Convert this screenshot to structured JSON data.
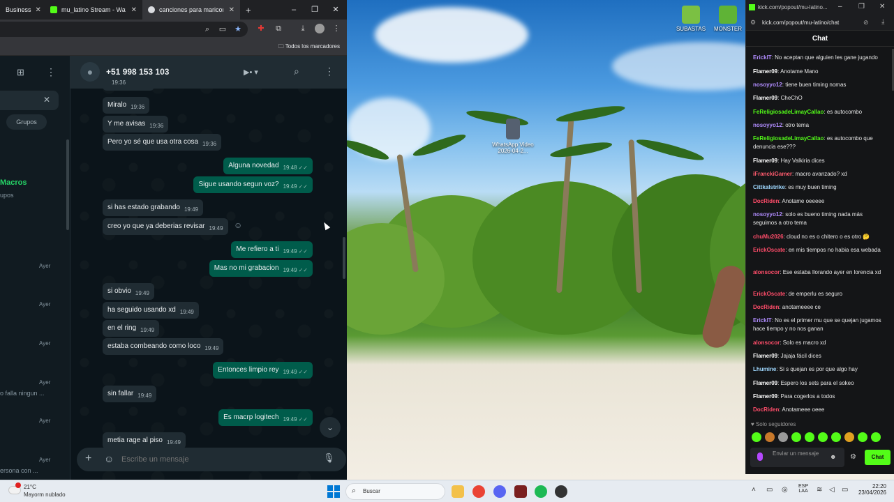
{
  "browser": {
    "tabs": [
      {
        "label": "Business",
        "close": "✕"
      },
      {
        "label": "mu_latino Stream - Watch",
        "close": "✕"
      },
      {
        "label": "canciones para maricones",
        "close": "✕"
      }
    ],
    "new_tab": "+",
    "bookmarks_label": "Todos los marcadores",
    "window_controls": [
      "–",
      "❐",
      "✕"
    ]
  },
  "wa_left": {
    "close_icon": "✕",
    "filter_chip": "Grupos",
    "chat_name_partial": "Macros",
    "chat_sub_partial": "upos",
    "times": [
      "Ayer",
      "Ayer",
      "Ayer",
      "Ayer",
      "Ayer",
      "Ayer"
    ],
    "preview_1": "o falla ningun ...",
    "preview_2": "ersona con ..."
  },
  "chat": {
    "contact": "+51 998 153 103",
    "messages": [
      {
        "dir": "in",
        "text": "",
        "time": "19:36"
      },
      {
        "dir": "in",
        "text": "Miralo",
        "time": "19:36"
      },
      {
        "dir": "in",
        "text": "Y me avisas",
        "time": "19:36"
      },
      {
        "dir": "in",
        "text": "Pero yo sé que usa otra cosa",
        "time": "19:36"
      },
      {
        "dir": "out",
        "text": "Alguna novedad",
        "time": "19:48"
      },
      {
        "dir": "out",
        "text": "Sigue usando segun voz?",
        "time": "19:49"
      },
      {
        "dir": "in",
        "text": "si has estado grabando",
        "time": "19:49"
      },
      {
        "dir": "in",
        "text": "creo yo que ya deberias revisar",
        "time": "19:49"
      },
      {
        "dir": "out",
        "text": "Me refiero a ti",
        "time": "19:49"
      },
      {
        "dir": "out",
        "text": "Mas no mi grabacion",
        "time": "19:49"
      },
      {
        "dir": "in",
        "text": "si obvio",
        "time": "19:49"
      },
      {
        "dir": "in",
        "text": "ha seguido usando xd",
        "time": "19:49"
      },
      {
        "dir": "in",
        "text": "en el ring",
        "time": "19:49"
      },
      {
        "dir": "in",
        "text": "estaba combeando como loco",
        "time": "19:49"
      },
      {
        "dir": "out",
        "text": "Entonces limpio rey",
        "time": "19:49"
      },
      {
        "dir": "in",
        "text": "sin fallar",
        "time": "19:49"
      },
      {
        "dir": "out",
        "text": "Es macrp logitech",
        "time": "19:49"
      },
      {
        "dir": "in",
        "text": "metia rage al piso",
        "time": "19:49"
      }
    ],
    "tick": "✓✓",
    "compose_placeholder": "Escribe un mensaje"
  },
  "desktop": {
    "icons": [
      {
        "label": "SUBASTAS"
      },
      {
        "label": "MONSTER"
      },
      {
        "label": "WhatsApp Video 2026-04-2..."
      }
    ]
  },
  "kick": {
    "url": "kick.com/popout/mu-latino/chat",
    "tab_url": "kick.com/popout/mu-latino...",
    "header": "Chat",
    "messages": [
      {
        "user": "ErickIT",
        "color": "#b18cff",
        "text": "No aceptan que alguien les gane jugando"
      },
      {
        "user": "Flamer09",
        "color": "#ffffff",
        "text": "Anotame Mano"
      },
      {
        "user": "nosoyyo12",
        "color": "#b18cff",
        "text": "tiene buen timing nomas"
      },
      {
        "user": "Flamer09",
        "color": "#ffffff",
        "text": "CheChO"
      },
      {
        "user": "FeReligiosadeLimayCallao",
        "color": "#53fc18",
        "text": "es autocombo"
      },
      {
        "user": "nosoyyo12",
        "color": "#b18cff",
        "text": "otro tema"
      },
      {
        "user": "FeReligiosadeLimayCallao",
        "color": "#53fc18",
        "text": "es autocombo que denuncia ese???"
      },
      {
        "user": "Flamer09",
        "color": "#ffffff",
        "text": "Hay Valkiria dices"
      },
      {
        "user": "iFranckiGamer",
        "color": "#ff5b6e",
        "text": "macro avanzado? xd"
      },
      {
        "user": "Cittkalstrike",
        "color": "#9fd8ff",
        "text": "es muy buen timing"
      },
      {
        "user": "DocRiden",
        "color": "#ff4d6a",
        "text": "Anotame oeeeee"
      },
      {
        "user": "nosoyyo12",
        "color": "#b18cff",
        "text": "solo es bueno timing nada más seguimos a otro tema"
      },
      {
        "user": "chuMu2026",
        "color": "#ff4d6a",
        "text": "cloud no es o chitero o es otro 🤔"
      },
      {
        "user": "ErickOscate",
        "color": "#ff4d6a",
        "text": "en mis tiempos no habia esa webada"
      },
      {
        "user": "alonsocor",
        "color": "#ff4d6a",
        "text": "Ese estaba llorando ayer en lorencia xd"
      },
      {
        "user": "ErickOscate",
        "color": "#ff4d6a",
        "text": "de emperlu es seguro"
      },
      {
        "user": "DocRiden",
        "color": "#ff4d6a",
        "text": "anotameeee ce"
      },
      {
        "user": "ErickIT",
        "color": "#b18cff",
        "text": "No es el primer mu que se quejan jugamos hace tiempo y no nos ganan"
      },
      {
        "user": "alonsocor",
        "color": "#ff4d6a",
        "text": "Solo es macro xd"
      },
      {
        "user": "Flamer09",
        "color": "#ffffff",
        "text": "Jajaja fácil dices"
      },
      {
        "user": "Lhumine",
        "color": "#9fd8ff",
        "text": "Si s quejan es por que algo hay"
      },
      {
        "user": "Flamer09",
        "color": "#ffffff",
        "text": "Espero los sets para el sokeo"
      },
      {
        "user": "Flamer09",
        "color": "#ffffff",
        "text": "Para cogerlos a todos"
      },
      {
        "user": "DocRiden",
        "color": "#ff4d6a",
        "text": "Anotameee oeee"
      }
    ],
    "followers_only": "♥ Solo seguidores",
    "input_placeholder": "Enviar un mensaje",
    "chat_button": "Chat",
    "window_controls": [
      "–",
      "❐",
      "✕"
    ]
  },
  "taskbar": {
    "weather_temp": "21°C",
    "weather_text": "Mayorm nublado",
    "search_placeholder": "Buscar",
    "lang": "ESP",
    "lang2": "LAA",
    "time": "22:20",
    "date": "23/04/2026"
  },
  "colors": {
    "wa_bg": "#0b141a",
    "wa_out": "#005c4b",
    "wa_in": "#202c33",
    "kick_green": "#53fc18"
  }
}
